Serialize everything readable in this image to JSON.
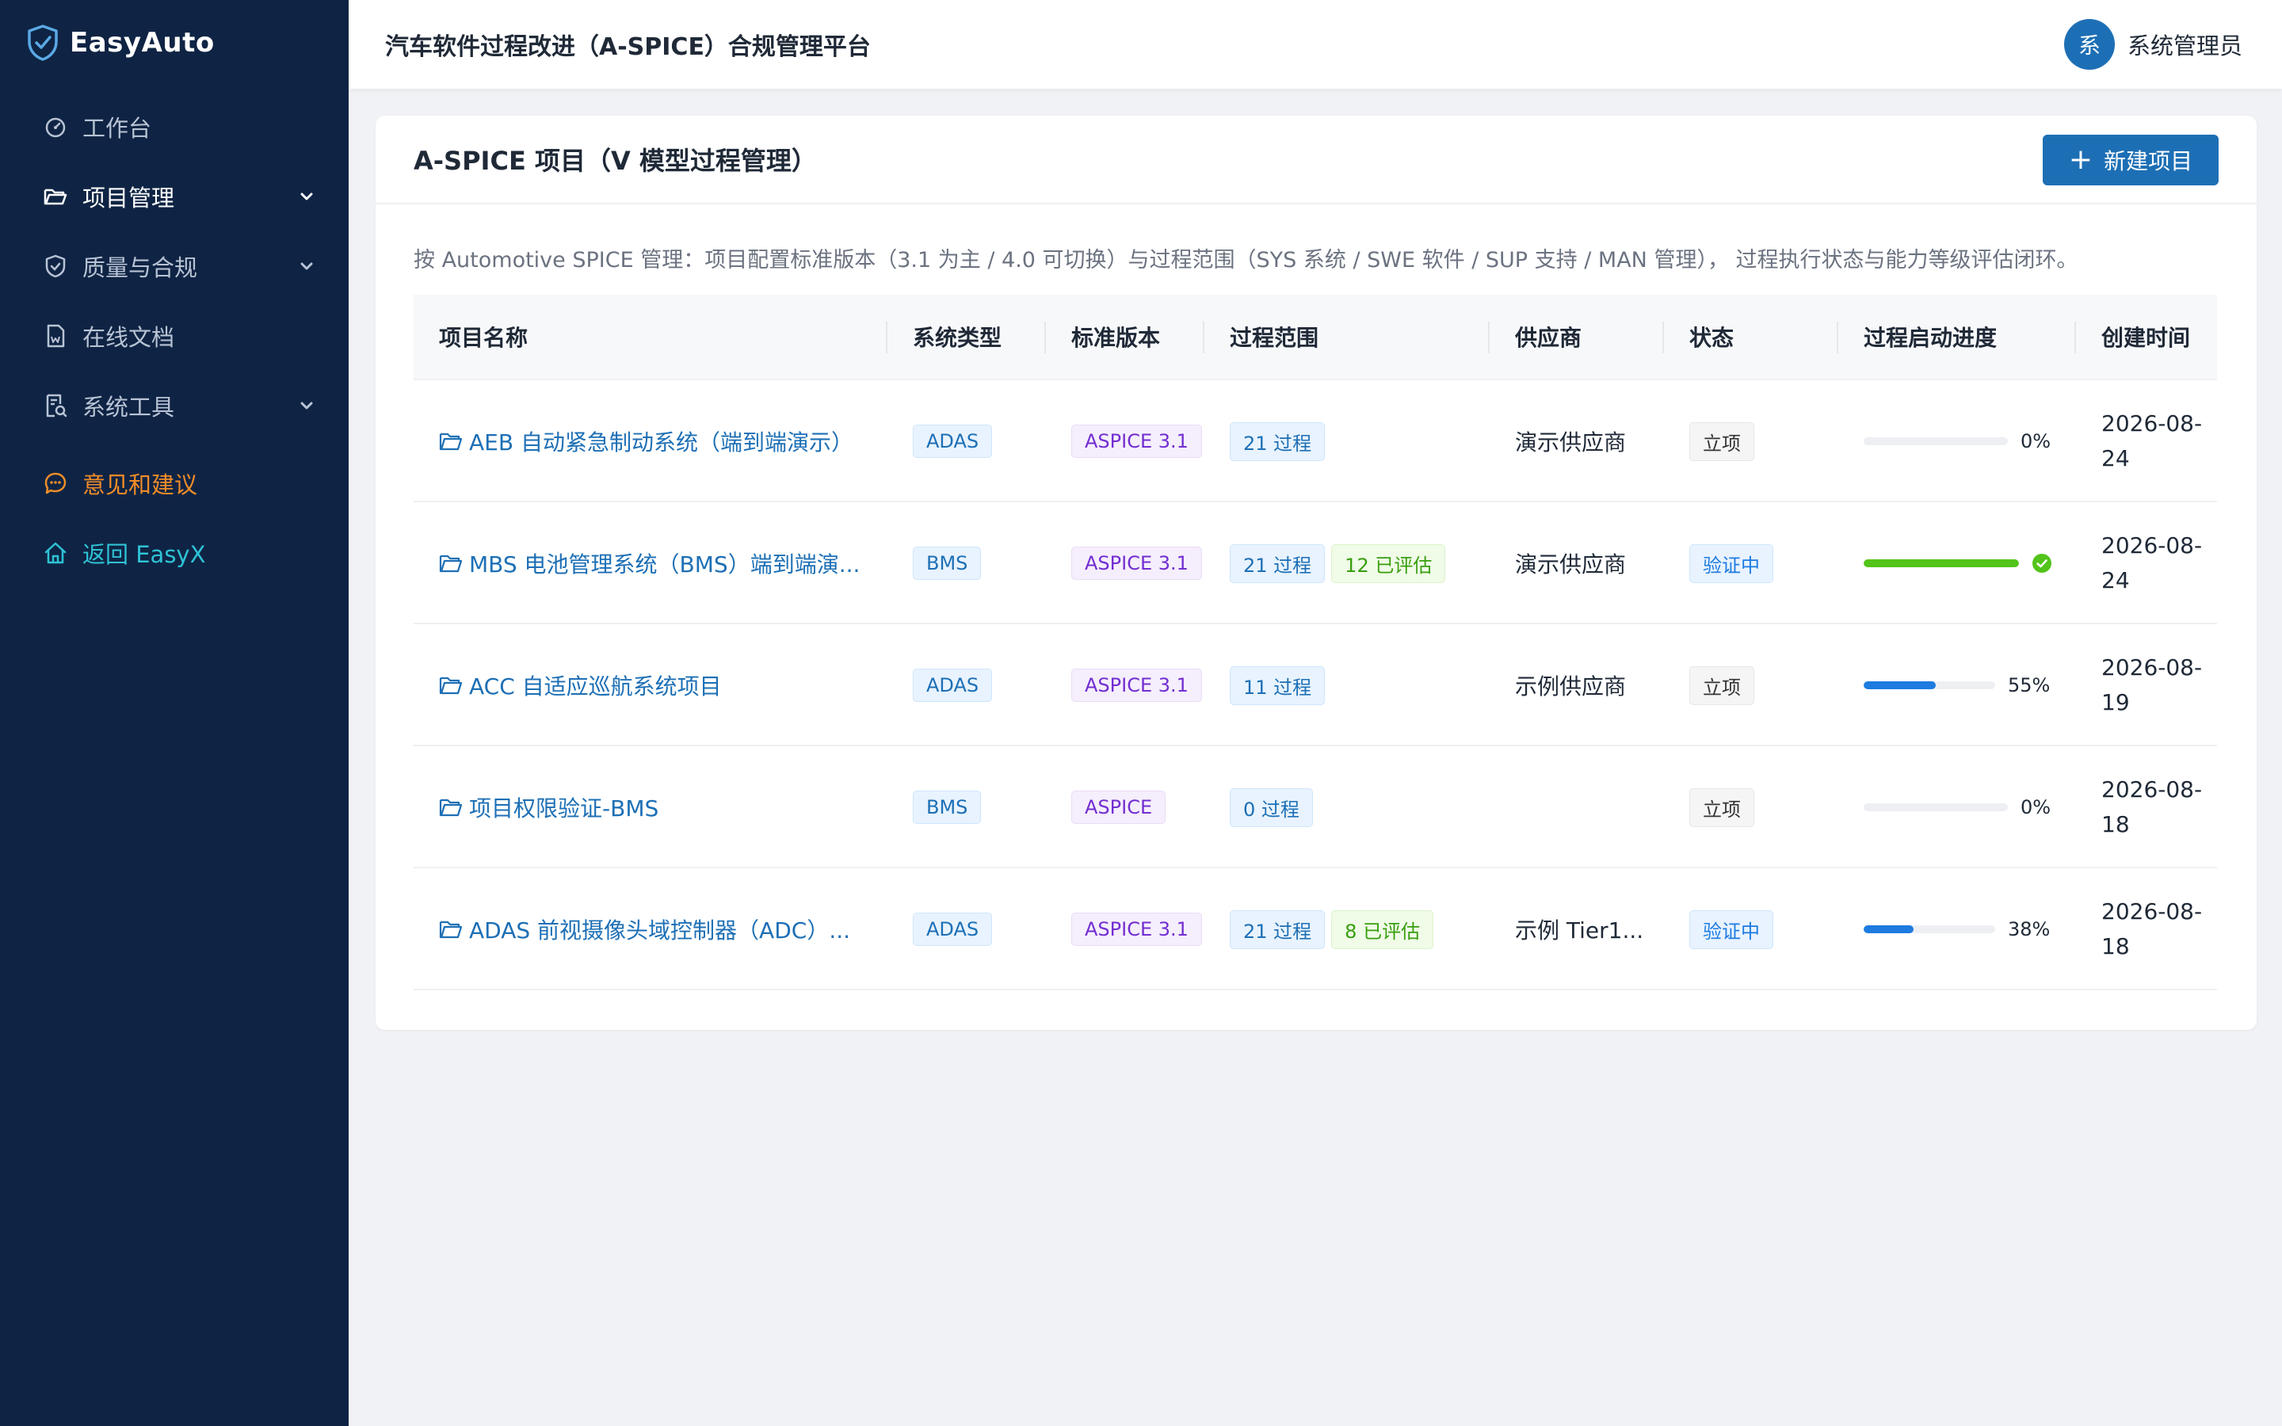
{
  "app": {
    "logo_text": "EasyAuto"
  },
  "sidebar": {
    "items": [
      {
        "label": "工作台",
        "icon": "dashboard-icon"
      },
      {
        "label": "项目管理",
        "icon": "folder-icon",
        "active": true,
        "expandable": true
      },
      {
        "label": "质量与合规",
        "icon": "shield-icon",
        "expandable": true
      },
      {
        "label": "在线文档",
        "icon": "document-icon"
      },
      {
        "label": "系统工具",
        "icon": "tools-icon",
        "expandable": true
      },
      {
        "label": "意见和建议",
        "icon": "chat-icon",
        "color": "#f08c28"
      },
      {
        "label": "返回 EasyX",
        "icon": "home-icon",
        "color": "#2fc2d6"
      }
    ]
  },
  "header": {
    "title": "汽车软件过程改进（A-SPICE）合规管理平台",
    "user": {
      "avatar_text": "系",
      "name": "系统管理员"
    }
  },
  "main": {
    "card_title": "A-SPICE 项目（V 模型过程管理）",
    "new_button": "新建项目",
    "description": "按 Automotive SPICE 管理：项目配置标准版本（3.1 为主 / 4.0 可切换）与过程范围（SYS 系统 / SWE 软件 / SUP 支持 / MAN 管理）， 过程执行状态与能力等级评估闭环。",
    "columns": [
      "项目名称",
      "系统类型",
      "标准版本",
      "过程范围",
      "供应商",
      "状态",
      "过程启动进度",
      "创建时间"
    ],
    "rows": [
      {
        "name": "AEB 自动紧急制动系统（端到端演示）",
        "type": "ADAS",
        "standard": "ASPICE 3.1",
        "scope": "21 过程",
        "assessed": "",
        "vendor": "演示供应商",
        "status": "立项",
        "status_style": "gray",
        "progress": 0,
        "progress_label": "0%",
        "date": "2026-08-24"
      },
      {
        "name": "MBS 电池管理系统（BMS）端到端演...",
        "type": "BMS",
        "standard": "ASPICE 3.1",
        "scope": "21 过程",
        "assessed": "12 已评估",
        "vendor": "演示供应商",
        "status": "验证中",
        "status_style": "blue",
        "progress": 100,
        "progress_label": "",
        "date": "2026-08-24"
      },
      {
        "name": "ACC 自适应巡航系统项目",
        "type": "ADAS",
        "standard": "ASPICE 3.1",
        "scope": "11 过程",
        "assessed": "",
        "vendor": "示例供应商",
        "status": "立项",
        "status_style": "gray",
        "progress": 55,
        "progress_label": "55%",
        "date": "2026-08-19"
      },
      {
        "name": "项目权限验证-BMS",
        "type": "BMS",
        "standard": "ASPICE",
        "scope": "0 过程",
        "assessed": "",
        "vendor": "",
        "status": "立项",
        "status_style": "gray",
        "progress": 0,
        "progress_label": "0%",
        "date": "2026-08-18"
      },
      {
        "name": "ADAS 前视摄像头域控制器（ADC）...",
        "type": "ADAS",
        "standard": "ASPICE 3.1",
        "scope": "21 过程",
        "assessed": "8 已评估",
        "vendor": "示例 Tier1...",
        "status": "验证中",
        "status_style": "blue",
        "progress": 38,
        "progress_label": "38%",
        "date": "2026-08-18"
      }
    ]
  },
  "colors": {
    "sidebar_bg": "#0f2444",
    "primary": "#1d6fb5",
    "progress_blue": "#1d7be0",
    "progress_green": "#52c41a",
    "feedback": "#f08c28",
    "back": "#2fc2d6"
  }
}
